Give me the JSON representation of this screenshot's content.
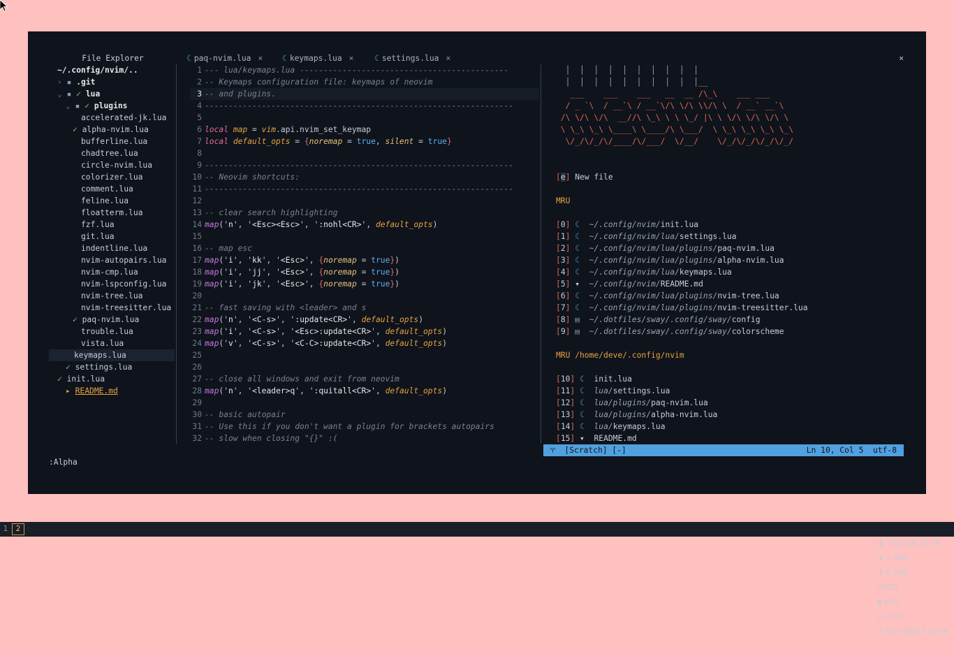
{
  "desktop": {
    "background": "#ffc0c0"
  },
  "tabline": {
    "explorer_title": "File Explorer",
    "tabs": [
      {
        "label": "paq-nvim.lua",
        "close": "×"
      },
      {
        "label": "keymaps.lua",
        "close": "×"
      },
      {
        "label": "settings.lua",
        "close": "×"
      }
    ],
    "close_all": "×"
  },
  "tree": {
    "root": "~/.config/nvim/..",
    "rows": [
      {
        "arrow": "›",
        "icon": "▪",
        "check": "",
        "name": ".git"
      },
      {
        "arrow": "⌄",
        "icon": "▪",
        "check": "✓",
        "name": "lua"
      },
      {
        "arrow": "⌄",
        "icon": "▪",
        "check": "✓",
        "name": "plugins"
      },
      {
        "name": "accelerated-jk.lua"
      },
      {
        "check": "✓",
        "name": "alpha-nvim.lua"
      },
      {
        "name": "bufferline.lua"
      },
      {
        "name": "chadtree.lua"
      },
      {
        "name": "circle-nvim.lua"
      },
      {
        "name": "colorizer.lua"
      },
      {
        "name": "comment.lua"
      },
      {
        "name": "feline.lua"
      },
      {
        "name": "floatterm.lua"
      },
      {
        "name": "fzf.lua"
      },
      {
        "name": "git.lua"
      },
      {
        "name": "indentline.lua"
      },
      {
        "name": "nvim-autopairs.lua"
      },
      {
        "name": "nvim-cmp.lua"
      },
      {
        "name": "nvim-lspconfig.lua"
      },
      {
        "name": "nvim-tree.lua"
      },
      {
        "name": "nvim-treesitter.lua"
      },
      {
        "check": "✓",
        "name": "paq-nvim.lua"
      },
      {
        "name": "trouble.lua"
      },
      {
        "name": "vista.lua"
      },
      {
        "name": "keymaps.lua"
      },
      {
        "check": "✓",
        "name": "settings.lua"
      },
      {
        "check": "✓",
        "name": "init.lua"
      },
      {
        "name": "README.md"
      }
    ]
  },
  "editor": {
    "lines": [
      "--- lua/keymaps.lua --------------------------------------------",
      "-- Keymaps configuration file: keymaps of neovim",
      "-- and plugins.",
      "-----------------------------------------------------------------",
      "",
      "local map = vim.api.nvim_set_keymap",
      "local default_opts = {noremap = true, silent = true}",
      "",
      "-----------------------------------------------------------------",
      "-- Neovim shortcuts:",
      "-----------------------------------------------------------------",
      "",
      "-- clear search highlighting",
      "map('n', '<Esc><Esc>', ':nohl<CR>', default_opts)",
      "",
      "-- map esc",
      "map('i', 'kk', '<Esc>', {noremap = true})",
      "map('i', 'jj', '<Esc>', {noremap = true})",
      "map('i', 'jk', '<Esc>', {noremap = true})",
      "",
      "-- fast saving with <leader> and s",
      "map('n', '<C-s>', ':update<CR>', default_opts)",
      "map('i', '<C-s>', '<Esc>:update<CR>', default_opts)",
      "map('v', '<C-s>', '<C-C>:update<CR>', default_opts)",
      "",
      "",
      "-- close all windows and exit from neovim",
      "map('n', '<leader>q', ':quitall<CR>', default_opts)",
      "",
      "-- basic autopair",
      "-- Use this if you don't want a plugin for brackets autopairs",
      "-- slow when closing \"{}\" :("
    ],
    "current_line": 3
  },
  "dashboard": {
    "ascii": [
      "  │  │  │  │  │  │  │  │  │  │",
      "  │  │  │  │  │  │  │  │  │  │__",
      "   ___    ___    ___   __  __ /\\_\\    ___ ___",
      "  / _ `\\  / __`\\ / __`\\/\\ \\/\\ \\\\/\\ \\  / __` __`\\",
      " /\\ \\/\\ \\/\\  __//\\ \\_\\ \\ \\ \\_/ |\\ \\ \\/\\ \\/\\ \\/\\ \\",
      " \\ \\_\\ \\_\\ \\____\\ \\____/\\ \\___/  \\ \\_\\ \\_\\ \\_\\ \\_\\",
      "  \\/_/\\/_/\\/____/\\/___/  \\/__/    \\/_/\\/_/\\/_/\\/_/"
    ],
    "new_file": {
      "key": "e",
      "label": "New file"
    },
    "mru_title": "MRU",
    "mru": [
      {
        "key": "0",
        "icon": "lua",
        "dir": "~/.config/nvim/",
        "file": "init.lua"
      },
      {
        "key": "1",
        "icon": "lua",
        "dir": "~/.config/nvim/lua/",
        "file": "settings.lua"
      },
      {
        "key": "2",
        "icon": "lua",
        "dir": "~/.config/nvim/lua/plugins/",
        "file": "paq-nvim.lua"
      },
      {
        "key": "3",
        "icon": "lua",
        "dir": "~/.config/nvim/lua/plugins/",
        "file": "alpha-nvim.lua"
      },
      {
        "key": "4",
        "icon": "lua",
        "dir": "~/.config/nvim/lua/",
        "file": "keymaps.lua"
      },
      {
        "key": "5",
        "icon": "md",
        "dir": "~/.config/nvim/",
        "file": "README.md"
      },
      {
        "key": "6",
        "icon": "lua",
        "dir": "~/.config/nvim/lua/plugins/",
        "file": "nvim-tree.lua"
      },
      {
        "key": "7",
        "icon": "lua",
        "dir": "~/.config/nvim/lua/plugins/",
        "file": "nvim-treesitter.lua"
      },
      {
        "key": "8",
        "icon": "cfg",
        "dir": "~/.dotfiles/sway/.config/sway/",
        "file": "config"
      },
      {
        "key": "9",
        "icon": "cfg",
        "dir": "~/.dotfiles/sway/.config/sway/",
        "file": "colorscheme"
      }
    ],
    "mru_cwd_title": "MRU /home/deve/.config/nvim",
    "mru_cwd": [
      {
        "key": "10",
        "icon": "lua",
        "dir": "",
        "file": "init.lua"
      },
      {
        "key": "11",
        "icon": "lua",
        "dir": "lua/",
        "file": "settings.lua"
      },
      {
        "key": "12",
        "icon": "lua",
        "dir": "lua/plugins/",
        "file": "paq-nvim.lua"
      },
      {
        "key": "13",
        "icon": "lua",
        "dir": "lua/plugins/",
        "file": "alpha-nvim.lua"
      },
      {
        "key": "14",
        "icon": "lua",
        "dir": "lua/",
        "file": "keymaps.lua"
      },
      {
        "key": "15",
        "icon": "md",
        "dir": "",
        "file": "README.md"
      }
    ]
  },
  "statusline": {
    "mode_icon": "♈",
    "left": "[Scratch] [-]",
    "position": "Ln 10, Col 5",
    "encoding": "utf-8"
  },
  "cmdline": ":Alpha",
  "bar": {
    "workspaces": [
      {
        "label": "1",
        "active": false
      },
      {
        "label": "2",
        "active": true
      }
    ],
    "ip": "◉ 192.168.10.58",
    "down": "⬇ 1.3KB",
    "up": "⬆ 0.7KB",
    "disk": "37GB",
    "battery": "▮ 63%",
    "cpu": "⁂ 11%",
    "clock": "⊙ Mon 28/03 11:59"
  }
}
